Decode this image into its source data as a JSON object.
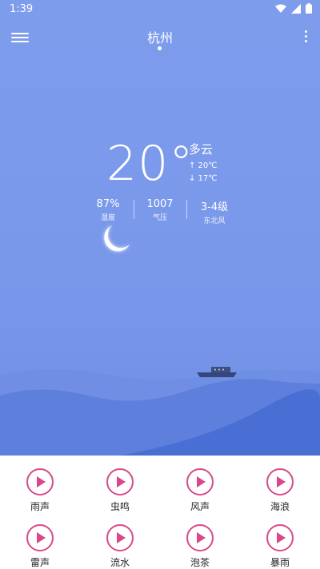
{
  "status_bar": {
    "time": "1:39"
  },
  "header": {
    "city": "杭州"
  },
  "weather": {
    "temperature": "20°",
    "condition": "多云",
    "high": "↑ 20℃",
    "low": "↓ 17℃",
    "stats": [
      {
        "value": "87%",
        "label": "湿度"
      },
      {
        "value": "1007",
        "label": "气压"
      },
      {
        "value": "3-4级",
        "label": "东北风"
      }
    ]
  },
  "sounds": [
    {
      "label": "雨声"
    },
    {
      "label": "虫鸣"
    },
    {
      "label": "风声"
    },
    {
      "label": "海浪"
    },
    {
      "label": "雷声"
    },
    {
      "label": "流水"
    },
    {
      "label": "泡茶"
    },
    {
      "label": "暴雨"
    }
  ],
  "colors": {
    "sky": "#7d9cec",
    "accent": "#d8488a",
    "wave_dark": "#4f73d6"
  }
}
